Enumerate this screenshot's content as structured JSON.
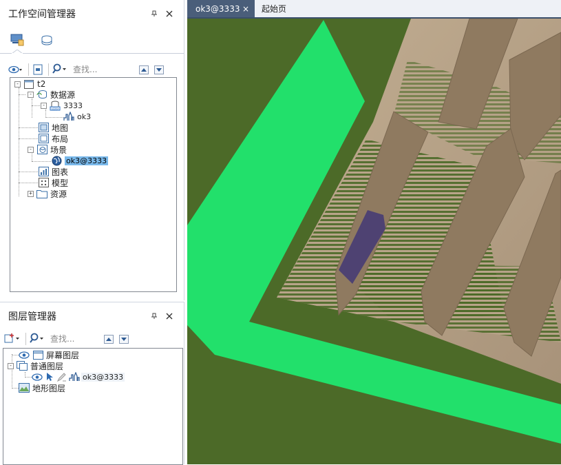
{
  "workspace_panel": {
    "title": "工作空间管理器",
    "pin_icon": "pin-icon",
    "close_icon": "close-icon",
    "tabs": [
      {
        "icon": "workspace-tree-icon",
        "active": true
      },
      {
        "icon": "datasource-cylinder-icon",
        "active": false
      }
    ],
    "search": {
      "placeholder": "查找..."
    },
    "tree": [
      {
        "label": "t2",
        "icon": "workspace-icon",
        "expander": "-"
      },
      {
        "label": "数据源",
        "icon": "datasources-icon",
        "expander": "-"
      },
      {
        "label": "3333",
        "icon": "datasource-udbx-icon",
        "expander": "-"
      },
      {
        "label": "ok3",
        "icon": "dataset-model-icon"
      },
      {
        "label": "地图",
        "icon": "maps-icon"
      },
      {
        "label": "布局",
        "icon": "layouts-icon"
      },
      {
        "label": "场景",
        "icon": "scenes-icon",
        "expander": "-"
      },
      {
        "label": "ok3@3333",
        "icon": "globe-icon",
        "selected": true
      },
      {
        "label": "图表",
        "icon": "charts-icon"
      },
      {
        "label": "模型",
        "icon": "models-icon"
      },
      {
        "label": "资源",
        "icon": "resources-icon",
        "expander": "+"
      }
    ]
  },
  "layer_panel": {
    "title": "图层管理器",
    "pin_icon": "pin-icon",
    "close_icon": "close-icon",
    "search": {
      "placeholder": "查找..."
    },
    "tree": [
      {
        "label": "屏幕图层",
        "icon": "screen-layer-icon"
      },
      {
        "label": "普通图层",
        "icon": "normal-layers-icon",
        "expander": "-"
      },
      {
        "label": "ok3@3333",
        "icons": [
          "visible-eye-icon",
          "selectable-icon",
          "editable-icon",
          "model-layer-icon"
        ]
      },
      {
        "label": "地形图层",
        "icon": "terrain-layer-icon"
      }
    ]
  },
  "document": {
    "tabs": [
      {
        "label": "ok3@3333",
        "active": true,
        "close": "×"
      },
      {
        "label": "起始页",
        "active": false
      }
    ]
  },
  "colors": {
    "scene_ground": "#4c6a28",
    "green_frame": "#22e06b",
    "beige": "#b59d80",
    "brown_panels": "#8f7a60",
    "purple_block": "#4e4272",
    "selection": "#79b8ea",
    "tab_active": "#4a5e7a"
  }
}
